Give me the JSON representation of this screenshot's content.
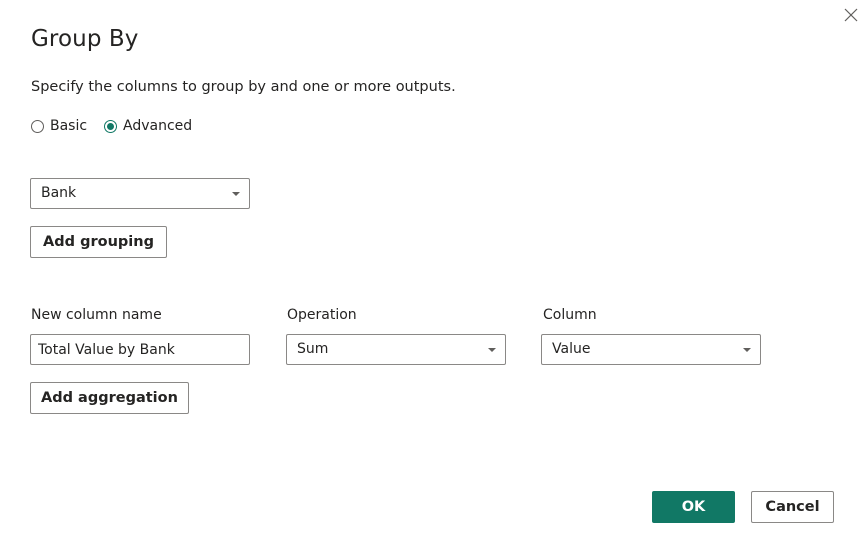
{
  "dialog": {
    "title": "Group By",
    "description": "Specify the columns to group by and one or more outputs.",
    "close_icon": "close-icon"
  },
  "mode": {
    "options": [
      {
        "label": "Basic",
        "selected": false
      },
      {
        "label": "Advanced",
        "selected": true
      }
    ]
  },
  "grouping": {
    "selected_column": "Bank",
    "add_label": "Add grouping"
  },
  "aggregation": {
    "headers": {
      "new_column_name": "New column name",
      "operation": "Operation",
      "column": "Column"
    },
    "new_column_value": "Total Value by Bank",
    "operation_value": "Sum",
    "column_value": "Value",
    "add_label": "Add aggregation"
  },
  "footer": {
    "ok_label": "OK",
    "cancel_label": "Cancel"
  },
  "colors": {
    "accent": "#117865",
    "border": "#8a8886",
    "text": "#252423"
  }
}
